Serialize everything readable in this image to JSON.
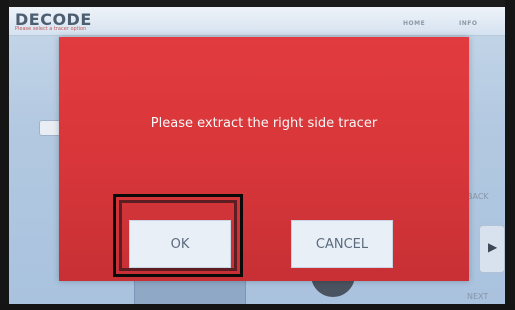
{
  "header": {
    "title": "DECODE",
    "subtitle": "Please select a tracer option",
    "nav_home": "HOME",
    "nav_info": "INFO"
  },
  "background": {
    "back_label": "BACK",
    "next_label": "NEXT",
    "arrow_icon": "chevron-right-icon",
    "arrow_glyph": "▶"
  },
  "dialog": {
    "message": "Please extract the right side tracer",
    "ok_label": "OK",
    "cancel_label": "CANCEL"
  },
  "colors": {
    "dialog_red": "#d8363a",
    "button_bg": "#e8eff7",
    "highlight_outer": "#0a0a0a",
    "highlight_inner": "#5c1e22"
  }
}
